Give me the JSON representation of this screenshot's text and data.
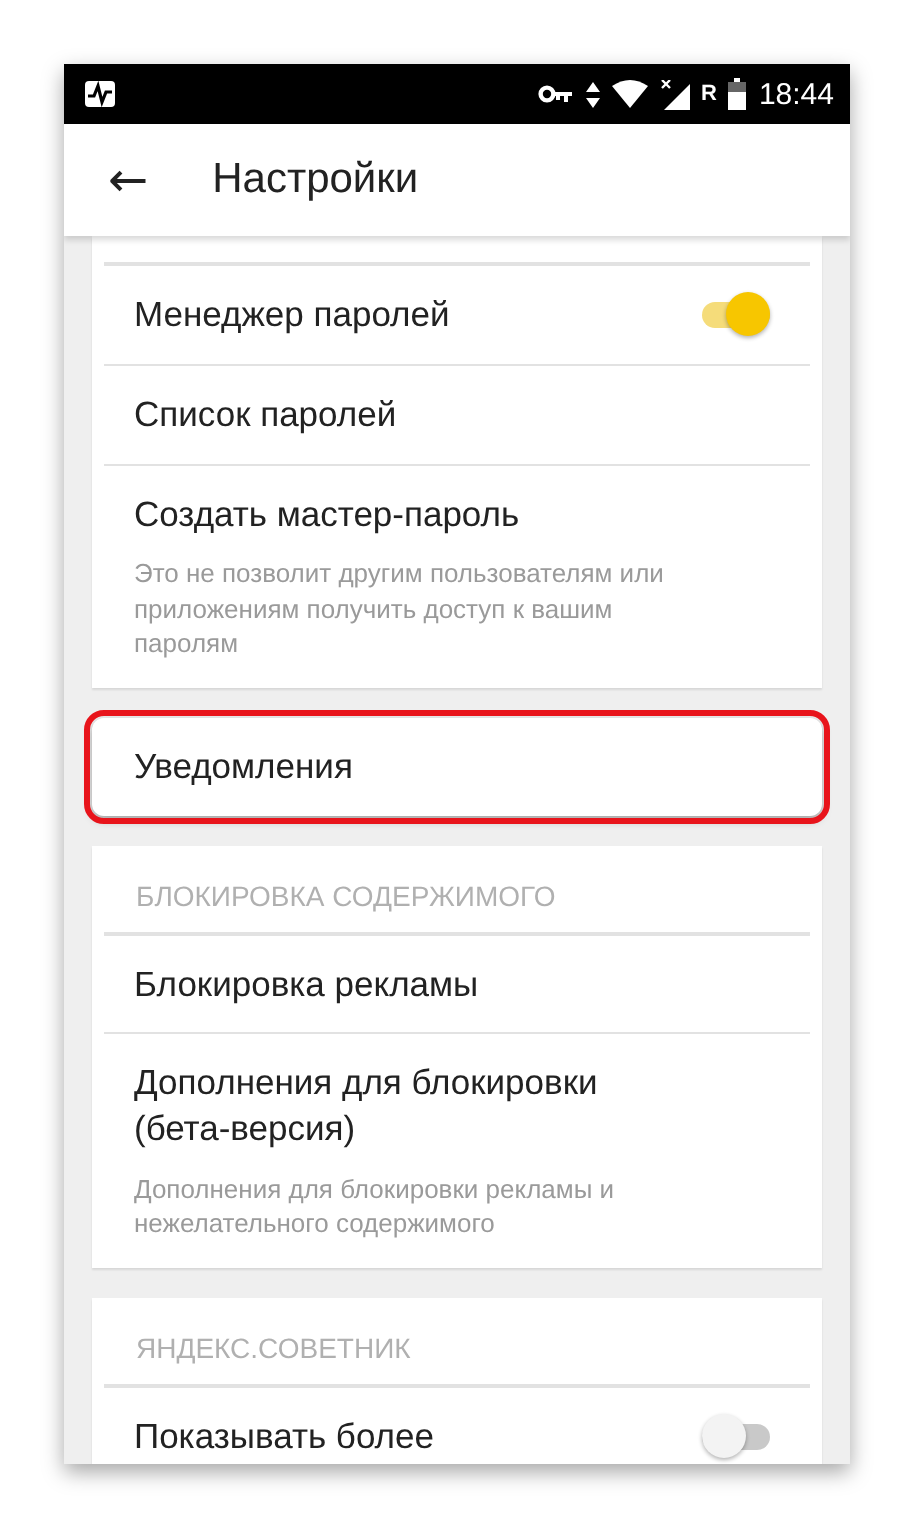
{
  "status_bar": {
    "network_mark": "R",
    "time": "18:44"
  },
  "app_bar": {
    "back": "←",
    "title": "Настройки"
  },
  "cards": [
    {
      "highlighted": false,
      "header_cut": true,
      "items": [
        {
          "kind": "toggle",
          "label": "Менеджер паролей",
          "on": true
        },
        {
          "kind": "link",
          "label": "Список паролей"
        },
        {
          "kind": "link",
          "label": "Создать мастер-пароль",
          "description": "Это не позволит другим пользователям или приложениям получить доступ к вашим паролям"
        }
      ]
    },
    {
      "highlighted": true,
      "items": [
        {
          "kind": "link",
          "label": "Уведомления"
        }
      ]
    },
    {
      "highlighted": false,
      "header": "БЛОКИРОВКА СОДЕРЖИМОГО",
      "items": [
        {
          "kind": "link",
          "label": "Блокировка рекламы"
        },
        {
          "kind": "link",
          "label": "Дополнения для блокировки (бета-версия)",
          "description": "Дополнения для блокировки рекламы и нежелательного содержимого"
        }
      ]
    },
    {
      "highlighted": false,
      "header": "ЯНДЕКС.СОВЕТНИК",
      "items": [
        {
          "kind": "toggle",
          "label": "Показывать более",
          "on": false
        }
      ]
    }
  ]
}
